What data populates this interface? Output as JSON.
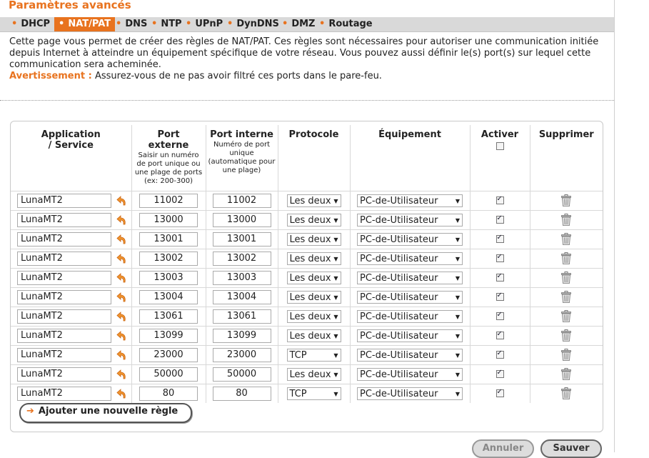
{
  "page": {
    "title": "Paramètres avancés"
  },
  "tabs": [
    {
      "label": "DHCP",
      "active": false
    },
    {
      "label": "NAT/PAT",
      "active": true
    },
    {
      "label": "DNS",
      "active": false
    },
    {
      "label": "NTP",
      "active": false
    },
    {
      "label": "UPnP",
      "active": false
    },
    {
      "label": "DynDNS",
      "active": false
    },
    {
      "label": "DMZ",
      "active": false
    },
    {
      "label": "Routage",
      "active": false
    }
  ],
  "intro": {
    "text": "Cette page vous permet de créer des règles de NAT/PAT. Ces règles sont nécessaires pour autoriser une communication initiée depuis Internet à atteindre un équipement spécifique de votre réseau. Vous pouvez aussi définir le(s) port(s) sur lequel cette communication sera acheminée.",
    "warning_label": "Avertissement :",
    "warning_text": " Assurez-vous de ne pas avoir filtré ces ports dans le pare-feu."
  },
  "table": {
    "headers": {
      "application": "Application / Service",
      "port_externe": "Port externe",
      "port_externe_hint": "Saisir un numéro de port unique ou une plage de ports (ex: 200-300)",
      "port_interne": "Port interne",
      "port_interne_hint": "Numéro de port unique (automatique pour une plage)",
      "protocole": "Protocole",
      "equipement": "Équipement",
      "activer": "Activer",
      "supprimer": "Supprimer"
    },
    "activer_all": false,
    "rows": [
      {
        "app": "LunaMT2",
        "ext": "11002",
        "int": "11002",
        "proto": "Les deux",
        "device": "PC-de-Utilisateur",
        "active": true
      },
      {
        "app": "LunaMT2",
        "ext": "13000",
        "int": "13000",
        "proto": "Les deux",
        "device": "PC-de-Utilisateur",
        "active": true
      },
      {
        "app": "LunaMT2",
        "ext": "13001",
        "int": "13001",
        "proto": "Les deux",
        "device": "PC-de-Utilisateur",
        "active": true
      },
      {
        "app": "LunaMT2",
        "ext": "13002",
        "int": "13002",
        "proto": "Les deux",
        "device": "PC-de-Utilisateur",
        "active": true
      },
      {
        "app": "LunaMT2",
        "ext": "13003",
        "int": "13003",
        "proto": "Les deux",
        "device": "PC-de-Utilisateur",
        "active": true
      },
      {
        "app": "LunaMT2",
        "ext": "13004",
        "int": "13004",
        "proto": "Les deux",
        "device": "PC-de-Utilisateur",
        "active": true
      },
      {
        "app": "LunaMT2",
        "ext": "13061",
        "int": "13061",
        "proto": "Les deux",
        "device": "PC-de-Utilisateur",
        "active": true
      },
      {
        "app": "LunaMT2",
        "ext": "13099",
        "int": "13099",
        "proto": "Les deux",
        "device": "PC-de-Utilisateur",
        "active": true
      },
      {
        "app": "LunaMT2",
        "ext": "23000",
        "int": "23000",
        "proto": "TCP",
        "device": "PC-de-Utilisateur",
        "active": true
      },
      {
        "app": "LunaMT2",
        "ext": "50000",
        "int": "50000",
        "proto": "Les deux",
        "device": "PC-de-Utilisateur",
        "active": true
      },
      {
        "app": "LunaMT2",
        "ext": "80",
        "int": "80",
        "proto": "TCP",
        "device": "PC-de-Utilisateur",
        "active": true
      }
    ]
  },
  "actions": {
    "add_rule": "Ajouter une nouvelle règle",
    "cancel": "Annuler",
    "save": "Sauver"
  },
  "colors": {
    "accent": "#e8731f",
    "tabbar": "#d9d9d9"
  }
}
